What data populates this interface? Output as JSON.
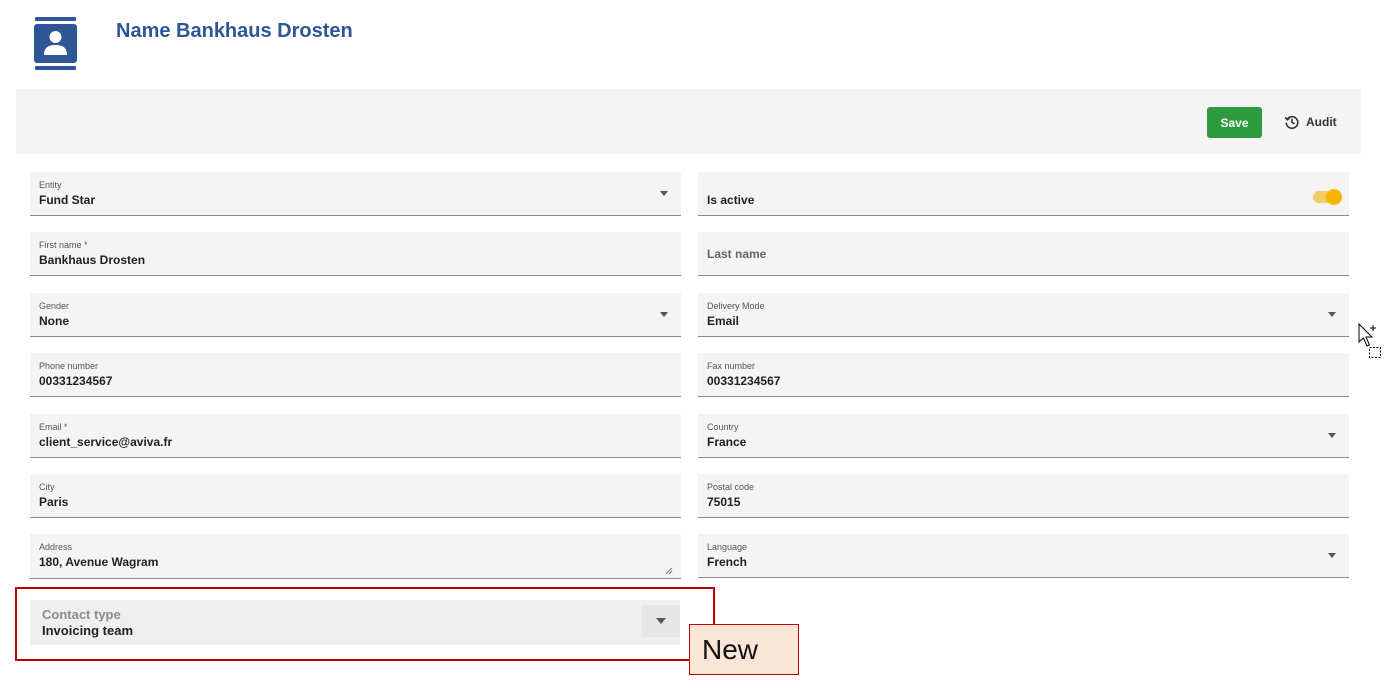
{
  "header": {
    "title": "Name Bankhaus Drosten",
    "icon": "contact-card-icon",
    "icon_color": "#2f5597"
  },
  "toolbar": {
    "save_label": "Save",
    "audit_label": "Audit",
    "audit_icon": "history-icon",
    "save_color": "#2e9a3e"
  },
  "form": {
    "entity": {
      "label": "Entity",
      "value": "Fund Star"
    },
    "is_active": {
      "label": "Is active",
      "checked": true,
      "accent_color": "#f5b400"
    },
    "first_name": {
      "label": "First name *",
      "value": "Bankhaus Drosten"
    },
    "last_name": {
      "placeholder": "Last name"
    },
    "gender": {
      "label": "Gender",
      "value": "None"
    },
    "delivery_mode": {
      "label": "Delivery Mode",
      "value": "Email"
    },
    "phone_number": {
      "label": "Phone number",
      "value": "00331234567"
    },
    "fax_number": {
      "label": "Fax number",
      "value": "00331234567"
    },
    "email": {
      "label": "Email *",
      "value": "client_service@aviva.fr"
    },
    "country": {
      "label": "Country",
      "value": "France"
    },
    "city": {
      "label": "City",
      "value": "Paris"
    },
    "postal_code": {
      "label": "Postal code",
      "value": "75015"
    },
    "address": {
      "label": "Address",
      "value": "180, Avenue Wagram"
    },
    "language": {
      "label": "Language",
      "value": "French"
    },
    "contact_type": {
      "label": "Contact type",
      "value": "Invoicing team"
    }
  },
  "annotation": {
    "callout_text": "New",
    "frame_color": "#c00000",
    "callout_fill": "#fbe5d6"
  }
}
